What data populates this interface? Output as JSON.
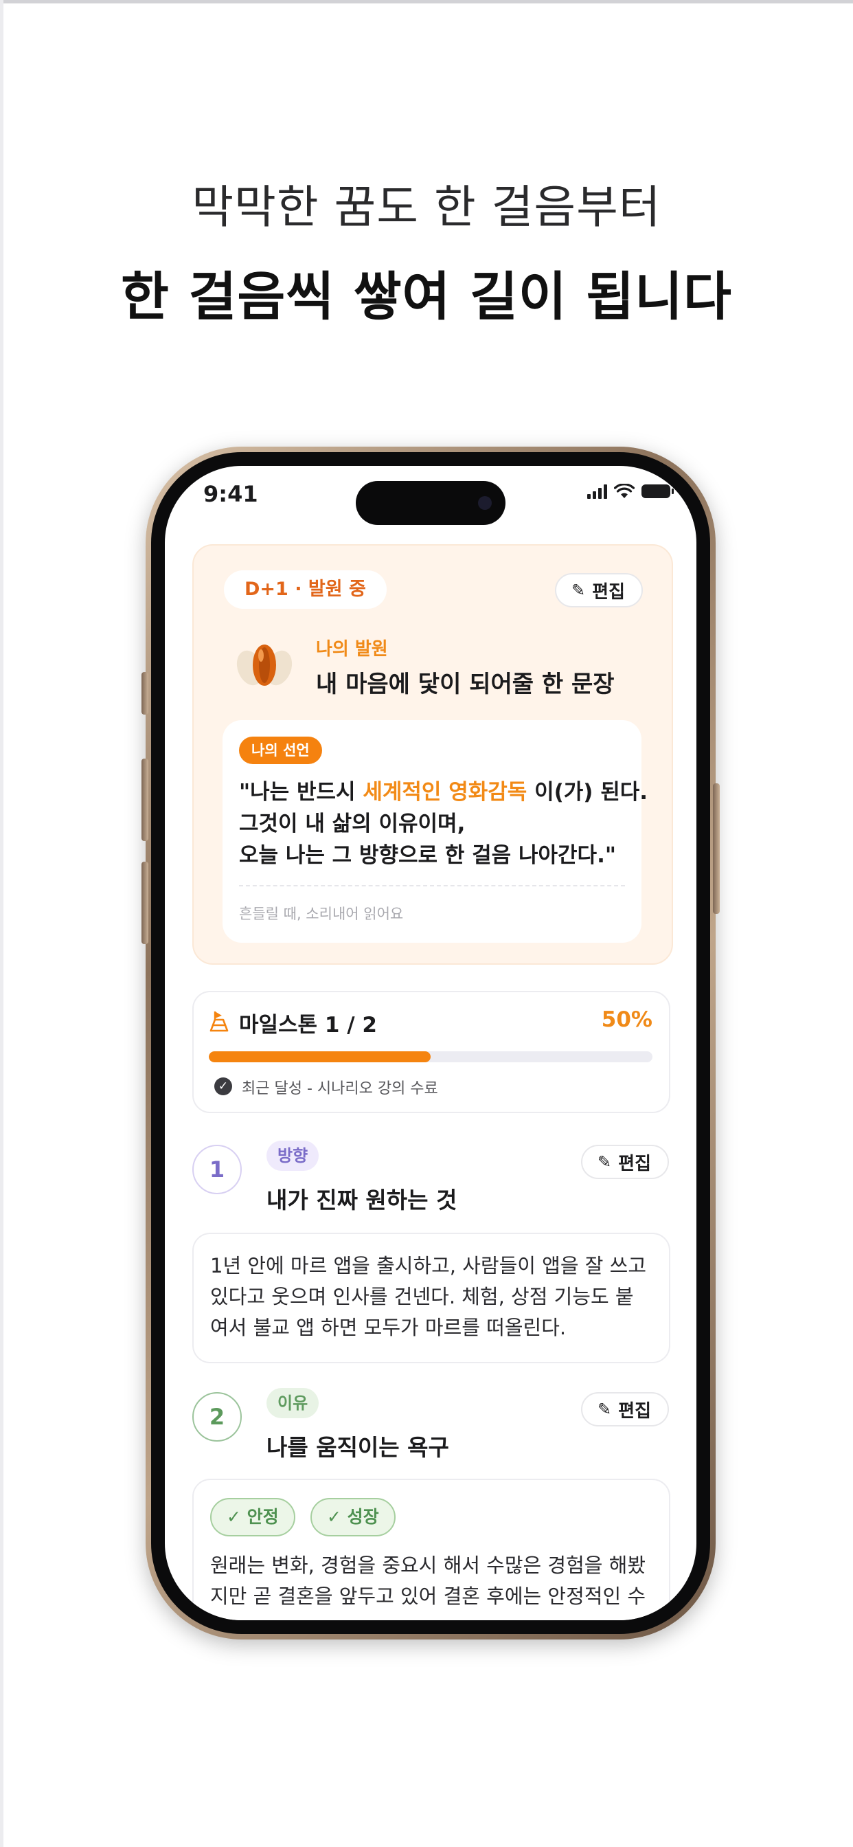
{
  "marketing": {
    "headline_line1": "막막한 꿈도 한 걸음부터",
    "headline_line2": "한 걸음씩 쌓여 길이 됩니다"
  },
  "status_bar": {
    "time": "9:41",
    "icons": [
      "cellular-signal-icon",
      "wifi-icon",
      "battery-icon"
    ]
  },
  "hero_card": {
    "day_status": "D+1 · 발원 중",
    "edit_label": "편집",
    "wish_label": "나의 발원",
    "wish_title": "내 마음에 닻이 되어줄 한 문장",
    "declaration": {
      "tag": "나의 선언",
      "line1_prefix": "\"나는 반드시 ",
      "line1_highlight": "세계적인 영화감독",
      "line1_suffix": " 이(가) 된다.",
      "line2": "그것이 내 삶의 이유이며,",
      "line3": "오늘 나는 그 방향으로 한 걸음 나아간다.\"",
      "hint": "흔들릴 때, 소리내어 읽어요"
    }
  },
  "milestone": {
    "title": "마일스톤 1 / 2",
    "percent_label": "50%",
    "progress": 0.5,
    "recent": "최근 달성 - 시나리오 강의 수료"
  },
  "sections": [
    {
      "number": "1",
      "chip": "방향",
      "title": "내가 진짜 원하는 것",
      "edit_label": "편집",
      "body_lines": [
        "1년 안에 마르 앱을 출시하고, 사람들이 앱을 잘 쓰고",
        "있다고 웃으며 인사를 건넨다. 체험, 상점 기능도 붙",
        "여서 불교 앱 하면 모두가 마르를 떠올린다."
      ]
    },
    {
      "number": "2",
      "chip": "이유",
      "title": "나를 움직이는 욕구",
      "edit_label": "편집",
      "values": [
        "✓ 안정",
        "✓ 성장"
      ],
      "body_lines": [
        "원래는 변화, 경험을 중요시 해서 수많은 경험을 해봤",
        "지만 곧 결혼을 앞두고 있어 결혼 후에는 안정적인 수"
      ]
    }
  ],
  "colors": {
    "accent_orange": "#F5840F",
    "hero_background": "#FFF4EA",
    "direction_purple": "#7A6CC8",
    "reason_green": "#5F9B5F"
  }
}
